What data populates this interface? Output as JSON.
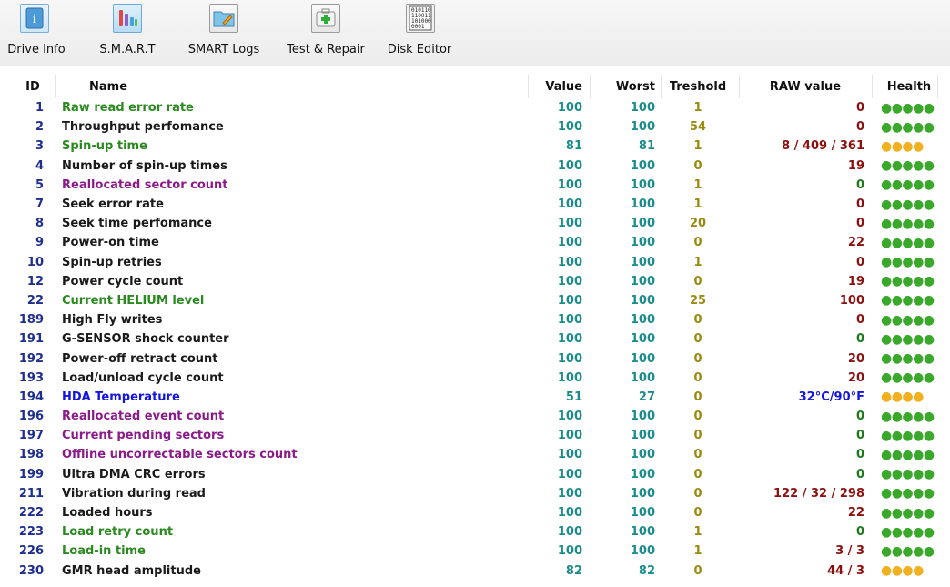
{
  "toolbar": {
    "items": [
      {
        "label": "Drive Info",
        "icon": "drive-info-icon"
      },
      {
        "label": "S.M.A.R.T",
        "icon": "smart-chart-icon"
      },
      {
        "label": "SMART Logs",
        "icon": "smart-logs-icon"
      },
      {
        "label": "Test & Repair",
        "icon": "test-repair-icon"
      },
      {
        "label": "Disk Editor",
        "icon": "disk-editor-icon"
      }
    ],
    "disk_editor_glyph": "010110\n110011\n101000\n0001"
  },
  "table": {
    "headers": {
      "id": "ID",
      "name": "Name",
      "value": "Value",
      "worst": "Worst",
      "treshold": "Treshold",
      "raw": "RAW value",
      "health": "Health"
    },
    "colors": {
      "green": "#2a8a1f",
      "black": "#1a1a1a",
      "purple": "#8b1a8b",
      "blue": "#1515e0",
      "teal": "#1a8c8c",
      "olive": "#9a8a10",
      "darkred": "#8b1010",
      "darkgreen": "#1a7a1a",
      "dot_green": "#3aa82a",
      "dot_yellow": "#f0b020"
    },
    "rows": [
      {
        "id": "1",
        "name": "Raw read error rate",
        "name_color": "green",
        "value": "100",
        "worst": "100",
        "treshold": "1",
        "raw": "0",
        "raw_color": "darkred",
        "health": "●●●●●",
        "health_color": "dot_green"
      },
      {
        "id": "2",
        "name": "Throughput perfomance",
        "name_color": "black",
        "value": "100",
        "worst": "100",
        "treshold": "54",
        "raw": "0",
        "raw_color": "darkred",
        "health": "●●●●●",
        "health_color": "dot_green"
      },
      {
        "id": "3",
        "name": "Spin-up time",
        "name_color": "green",
        "value": "81",
        "worst": "81",
        "treshold": "1",
        "raw": "8 / 409 / 361",
        "raw_color": "darkred",
        "health": "●●●●",
        "health_color": "dot_yellow"
      },
      {
        "id": "4",
        "name": "Number of spin-up times",
        "name_color": "black",
        "value": "100",
        "worst": "100",
        "treshold": "0",
        "raw": "19",
        "raw_color": "darkred",
        "health": "●●●●●",
        "health_color": "dot_green"
      },
      {
        "id": "5",
        "name": "Reallocated sector count",
        "name_color": "purple",
        "value": "100",
        "worst": "100",
        "treshold": "1",
        "raw": "0",
        "raw_color": "darkgreen",
        "health": "●●●●●",
        "health_color": "dot_green"
      },
      {
        "id": "7",
        "name": "Seek error rate",
        "name_color": "black",
        "value": "100",
        "worst": "100",
        "treshold": "1",
        "raw": "0",
        "raw_color": "darkred",
        "health": "●●●●●",
        "health_color": "dot_green"
      },
      {
        "id": "8",
        "name": "Seek time perfomance",
        "name_color": "black",
        "value": "100",
        "worst": "100",
        "treshold": "20",
        "raw": "0",
        "raw_color": "darkred",
        "health": "●●●●●",
        "health_color": "dot_green"
      },
      {
        "id": "9",
        "name": "Power-on time",
        "name_color": "black",
        "value": "100",
        "worst": "100",
        "treshold": "0",
        "raw": "22",
        "raw_color": "darkred",
        "health": "●●●●●",
        "health_color": "dot_green"
      },
      {
        "id": "10",
        "name": "Spin-up retries",
        "name_color": "black",
        "value": "100",
        "worst": "100",
        "treshold": "1",
        "raw": "0",
        "raw_color": "darkred",
        "health": "●●●●●",
        "health_color": "dot_green"
      },
      {
        "id": "12",
        "name": "Power cycle count",
        "name_color": "black",
        "value": "100",
        "worst": "100",
        "treshold": "0",
        "raw": "19",
        "raw_color": "darkred",
        "health": "●●●●●",
        "health_color": "dot_green"
      },
      {
        "id": "22",
        "name": "Current HELIUM level",
        "name_color": "green",
        "value": "100",
        "worst": "100",
        "treshold": "25",
        "raw": "100",
        "raw_color": "darkred",
        "health": "●●●●●",
        "health_color": "dot_green"
      },
      {
        "id": "189",
        "name": "High Fly writes",
        "name_color": "black",
        "value": "100",
        "worst": "100",
        "treshold": "0",
        "raw": "0",
        "raw_color": "darkred",
        "health": "●●●●●",
        "health_color": "dot_green"
      },
      {
        "id": "191",
        "name": "G-SENSOR shock counter",
        "name_color": "black",
        "value": "100",
        "worst": "100",
        "treshold": "0",
        "raw": "0",
        "raw_color": "darkgreen",
        "health": "●●●●●",
        "health_color": "dot_green"
      },
      {
        "id": "192",
        "name": "Power-off retract count",
        "name_color": "black",
        "value": "100",
        "worst": "100",
        "treshold": "0",
        "raw": "20",
        "raw_color": "darkred",
        "health": "●●●●●",
        "health_color": "dot_green"
      },
      {
        "id": "193",
        "name": "Load/unload cycle count",
        "name_color": "black",
        "value": "100",
        "worst": "100",
        "treshold": "0",
        "raw": "20",
        "raw_color": "darkred",
        "health": "●●●●●",
        "health_color": "dot_green"
      },
      {
        "id": "194",
        "name": "HDA Temperature",
        "name_color": "blue",
        "value": "51",
        "worst": "27",
        "treshold": "0",
        "raw": "32°C/90°F",
        "raw_color": "blue",
        "health": "●●●●",
        "health_color": "dot_yellow"
      },
      {
        "id": "196",
        "name": "Reallocated event count",
        "name_color": "purple",
        "value": "100",
        "worst": "100",
        "treshold": "0",
        "raw": "0",
        "raw_color": "darkgreen",
        "health": "●●●●●",
        "health_color": "dot_green"
      },
      {
        "id": "197",
        "name": "Current pending sectors",
        "name_color": "purple",
        "value": "100",
        "worst": "100",
        "treshold": "0",
        "raw": "0",
        "raw_color": "darkgreen",
        "health": "●●●●●",
        "health_color": "dot_green"
      },
      {
        "id": "198",
        "name": "Offline uncorrectable sectors count",
        "name_color": "purple",
        "value": "100",
        "worst": "100",
        "treshold": "0",
        "raw": "0",
        "raw_color": "darkgreen",
        "health": "●●●●●",
        "health_color": "dot_green"
      },
      {
        "id": "199",
        "name": "Ultra DMA CRC errors",
        "name_color": "black",
        "value": "100",
        "worst": "100",
        "treshold": "0",
        "raw": "0",
        "raw_color": "darkgreen",
        "health": "●●●●●",
        "health_color": "dot_green"
      },
      {
        "id": "211",
        "name": "Vibration during read",
        "name_color": "black",
        "value": "100",
        "worst": "100",
        "treshold": "0",
        "raw": "122 / 32 / 298",
        "raw_color": "darkred",
        "health": "●●●●●",
        "health_color": "dot_green"
      },
      {
        "id": "222",
        "name": "Loaded hours",
        "name_color": "black",
        "value": "100",
        "worst": "100",
        "treshold": "0",
        "raw": "22",
        "raw_color": "darkred",
        "health": "●●●●●",
        "health_color": "dot_green"
      },
      {
        "id": "223",
        "name": "Load retry count",
        "name_color": "green",
        "value": "100",
        "worst": "100",
        "treshold": "1",
        "raw": "0",
        "raw_color": "darkgreen",
        "health": "●●●●●",
        "health_color": "dot_green"
      },
      {
        "id": "226",
        "name": "Load-in time",
        "name_color": "green",
        "value": "100",
        "worst": "100",
        "treshold": "1",
        "raw": "3 / 3",
        "raw_color": "darkred",
        "health": "●●●●●",
        "health_color": "dot_green"
      },
      {
        "id": "230",
        "name": "GMR head amplitude",
        "name_color": "black",
        "value": "82",
        "worst": "82",
        "treshold": "0",
        "raw": "44 / 3",
        "raw_color": "darkred",
        "health": "●●●●",
        "health_color": "dot_yellow"
      }
    ]
  }
}
